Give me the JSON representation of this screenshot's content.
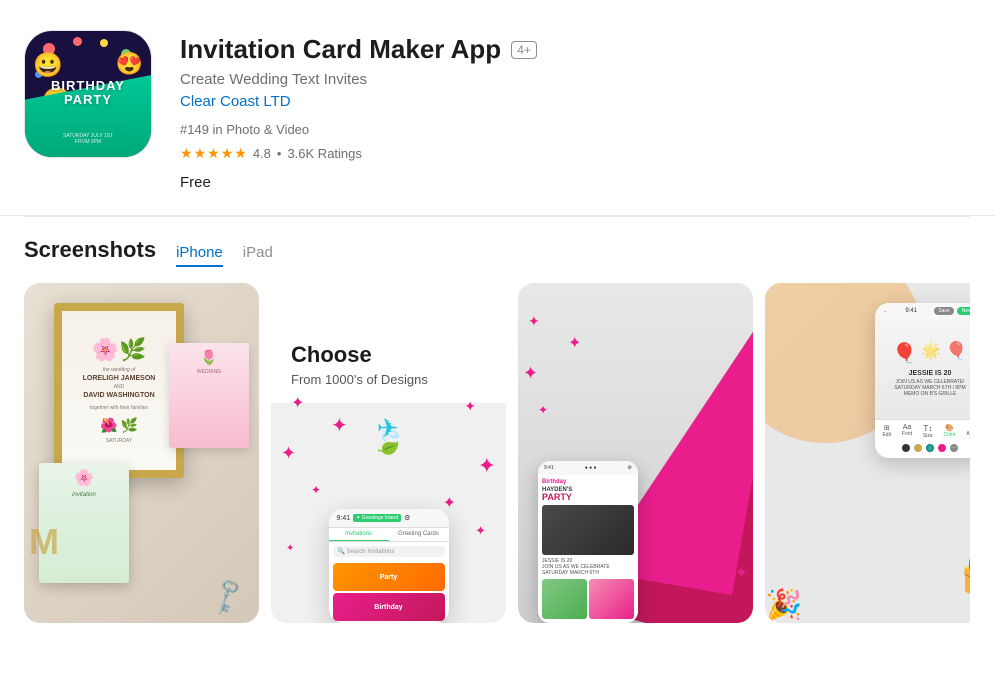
{
  "app": {
    "title": "Invitation Card Maker App",
    "age_rating": "4+",
    "subtitle": "Create Wedding Text Invites",
    "developer": "Clear Coast LTD",
    "rank": "#149 in Photo & Video",
    "rating": "4.8",
    "rating_separator": "•",
    "rating_count": "3.6K Ratings",
    "price": "Free",
    "stars": [
      "★",
      "★",
      "★",
      "★",
      "★"
    ]
  },
  "screenshots": {
    "section_title": "Screenshots",
    "device_tabs": [
      {
        "label": "iPhone",
        "active": true
      },
      {
        "label": "iPad",
        "active": false
      }
    ]
  },
  "choose_screen": {
    "title": "Choose",
    "subtitle": "From 1000's of Designs",
    "search_placeholder": "Search Invitations",
    "tabs": [
      "Invitations",
      "Greeting Cards"
    ],
    "cards": [
      {
        "label": "Party",
        "color": "#ff9500"
      },
      {
        "label": "Birthday",
        "color": "#e91e8c"
      }
    ]
  },
  "colors": {
    "accent_blue": "#0070c9",
    "star_orange": "#ff9500",
    "green_brand": "#2ecc71",
    "pink_party": "#e91e8c"
  },
  "icon": {
    "emojis": [
      "😀",
      "😍",
      "🎉"
    ],
    "title_line1": "BIRTHDAY",
    "title_line2": "PARTY"
  }
}
